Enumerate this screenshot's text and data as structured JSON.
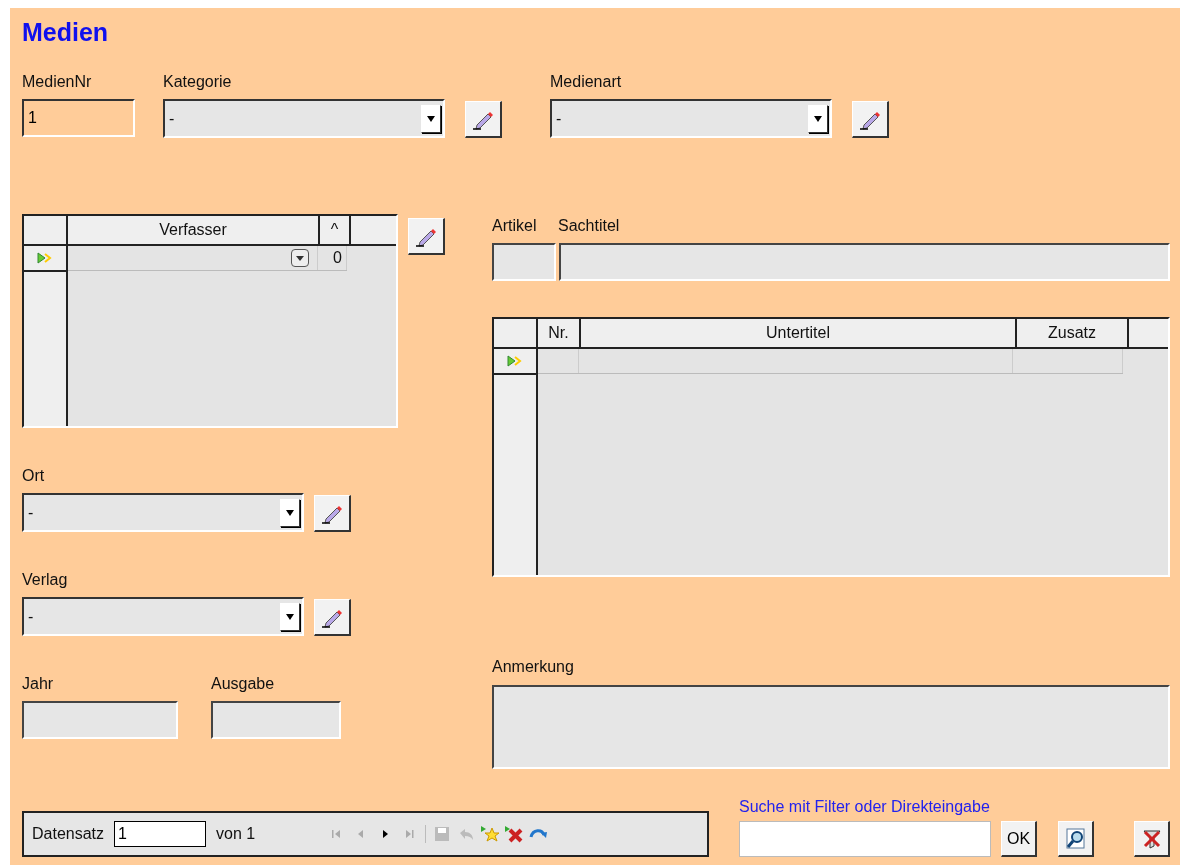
{
  "title": "Medien",
  "medien_nr": {
    "label": "MedienNr",
    "value": "1"
  },
  "kategorie": {
    "label": "Kategorie",
    "value": "-"
  },
  "medienart": {
    "label": "Medienart",
    "value": "-"
  },
  "authors_grid": {
    "columns": [
      "Verfasser",
      "^"
    ],
    "rows": [
      {
        "number": "0"
      }
    ]
  },
  "artikel": {
    "label": "Artikel"
  },
  "sachtitel": {
    "label": "Sachtitel"
  },
  "subtitles_grid": {
    "columns": [
      "Nr.",
      "Untertitel",
      "Zusatz"
    ]
  },
  "ort": {
    "label": "Ort",
    "value": "-"
  },
  "verlag": {
    "label": "Verlag",
    "value": "-"
  },
  "jahr": {
    "label": "Jahr"
  },
  "ausgabe": {
    "label": "Ausgabe"
  },
  "anmerkung": {
    "label": "Anmerkung"
  },
  "navigation": {
    "label": "Datensatz",
    "value": "1",
    "total": "von 1",
    "buttons": [
      {
        "kind": "first",
        "disabled": true
      },
      {
        "kind": "previous",
        "disabled": true
      },
      {
        "kind": "next",
        "disabled": false
      },
      {
        "kind": "last",
        "disabled": true
      },
      {
        "kind": "save",
        "disabled": true
      },
      {
        "kind": "undo",
        "disabled": true
      },
      {
        "kind": "new",
        "disabled": false
      },
      {
        "kind": "delete",
        "disabled": false
      },
      {
        "kind": "refresh",
        "disabled": false
      }
    ]
  },
  "search": {
    "label": "Suche mit Filter oder Direkteingabe",
    "ok": "OK"
  }
}
